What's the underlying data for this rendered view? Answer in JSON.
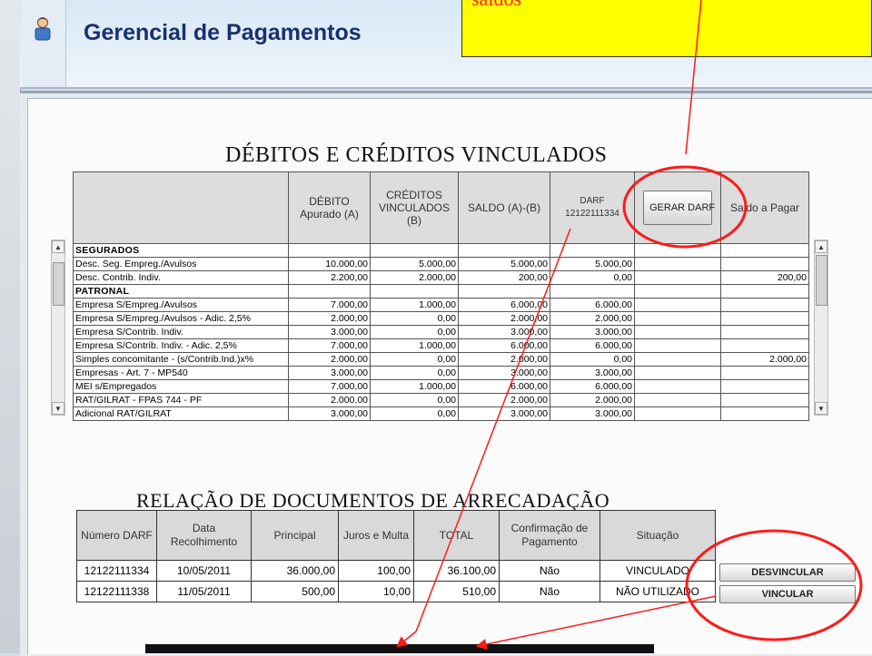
{
  "header": {
    "title": "Gerencial de Pagamentos"
  },
  "note": {
    "text": "saldos"
  },
  "debitos": {
    "title": "DÉBITOS E CRÉDITOS VINCULADOS",
    "headers": [
      "DÉBITO Apurado (A)",
      "CRÉDITOS VINCULADOS (B)",
      "SALDO (A)-(B)",
      "DARF 12122111334",
      "",
      "Saldo a Pagar"
    ],
    "gerar_button": "GERAR DARF",
    "rows": [
      {
        "label": "SEGURADOS",
        "group": true
      },
      {
        "label": "Desc. Seg. Empreg./Avulsos",
        "debito": "10.000,00",
        "credito": "5.000,00",
        "saldo": "5.000,00",
        "darf": "5.000,00",
        "pagar": ""
      },
      {
        "label": "Desc. Contrib. Indiv.",
        "debito": "2.200,00",
        "credito": "2.000,00",
        "saldo": "200,00",
        "darf": "0,00",
        "pagar": "200,00"
      },
      {
        "label": "PATRONAL",
        "group": true
      },
      {
        "label": "Empresa S/Empreg./Avulsos",
        "debito": "7.000,00",
        "credito": "1.000,00",
        "saldo": "6.000,00",
        "darf": "6.000,00",
        "pagar": ""
      },
      {
        "label": "Empresa S/Empreg./Avulsos - Adic. 2,5%",
        "debito": "2.000,00",
        "credito": "0,00",
        "saldo": "2.000,00",
        "darf": "2.000,00",
        "pagar": ""
      },
      {
        "label": "Empresa S/Contrib. Indiv.",
        "debito": "3.000,00",
        "credito": "0,00",
        "saldo": "3.000,00",
        "darf": "3.000,00",
        "pagar": ""
      },
      {
        "label": "Empresa S/Contrib. Indiv. - Adic. 2,5%",
        "debito": "7.000,00",
        "credito": "1.000,00",
        "saldo": "6.000,00",
        "darf": "6.000,00",
        "pagar": ""
      },
      {
        "label": "Simples concomitante - (s/Contrib.Ind.)x%",
        "debito": "2.000,00",
        "credito": "0,00",
        "saldo": "2.000,00",
        "darf": "0,00",
        "pagar": "2.000,00"
      },
      {
        "label": "Empresas - Art. 7 - MP540",
        "debito": "3.000,00",
        "credito": "0,00",
        "saldo": "3.000,00",
        "darf": "3.000,00",
        "pagar": ""
      },
      {
        "label": "MEI s/Empregados",
        "debito": "7.000,00",
        "credito": "1.000,00",
        "saldo": "6.000,00",
        "darf": "6.000,00",
        "pagar": ""
      },
      {
        "label": "RAT/GILRAT - FPAS 744 - PF",
        "debito": "2.000,00",
        "credito": "0,00",
        "saldo": "2.000,00",
        "darf": "2.000,00",
        "pagar": ""
      },
      {
        "label": "Adicional RAT/GILRAT",
        "debito": "3.000,00",
        "credito": "0,00",
        "saldo": "3.000,00",
        "darf": "3.000,00",
        "pagar": ""
      }
    ]
  },
  "documentos": {
    "title": "RELAÇÃO DE DOCUMENTOS DE ARRECADAÇÃO",
    "headers": [
      "Número DARF",
      "Data Recolhimento",
      "Principal",
      "Juros e Multa",
      "TOTAL",
      "Confirmação de Pagamento",
      "Situação"
    ],
    "rows": [
      {
        "numero": "12122111334",
        "data": "10/05/2011",
        "principal": "36.000,00",
        "juros": "100,00",
        "total": "36.100,00",
        "confirmacao": "Não",
        "situacao": "VINCULADO"
      },
      {
        "numero": "12122111338",
        "data": "11/05/2011",
        "principal": "500,00",
        "juros": "10,00",
        "total": "510,00",
        "confirmacao": "Não",
        "situacao": "NÃO UTILIZADO"
      }
    ],
    "desvincular_button": "DESVINCULAR",
    "vincular_button": "VINCULAR"
  },
  "colors": {
    "title": "#19306f",
    "annotation": "#ff1a1a",
    "note_bg": "#ffff00"
  },
  "icons": [
    "user-icon",
    "scroll-up-icon",
    "scroll-down-icon"
  ]
}
